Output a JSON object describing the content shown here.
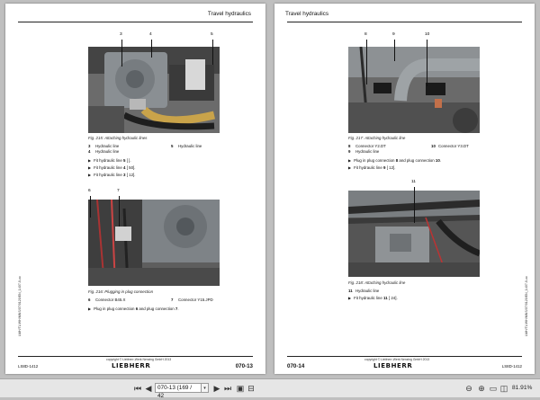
{
  "left_page": {
    "header": "Travel hydraulics",
    "fig1": {
      "callouts": [
        "3",
        "4",
        "5"
      ],
      "caption": "Fig. 215: Attaching hydraulic lines",
      "legend": [
        {
          "num": "3",
          "text": "Hydraulic line",
          "num2": "5",
          "text2": "Hydraulic line"
        },
        {
          "num": "4",
          "text": "Hydraulic line",
          "num2": "",
          "text2": ""
        }
      ],
      "steps": [
        {
          "pre": "Fit hydraulic line ",
          "num": "5",
          "post": " [ ]."
        },
        {
          "pre": "Fit hydraulic line ",
          "num": "4",
          "post": " [ 50]."
        },
        {
          "pre": "Fit hydraulic line ",
          "num": "3",
          "post": " [ 12]."
        }
      ]
    },
    "fig2": {
      "callouts": [
        "6",
        "7"
      ],
      "caption": "Fig. 216: Plugging in plug connection",
      "legend": [
        {
          "num": "6",
          "text": "Connector B45.X",
          "num2": "7",
          "text2": "Connector Y15.JPD"
        }
      ],
      "steps": [
        {
          "pre": "Plug in plug connection ",
          "num": "6",
          "post": " and plug connection ",
          "num_b": "7",
          "post_b": "."
        }
      ]
    },
    "side_code": "LMH/TL/WH/MNS/07/0120/EN_1407-0-xx",
    "copyright": "copyright © Liebherr-Werk Nenzing GmbH 2013",
    "logo": "LIEBHERR",
    "doc_id": "LS8D-1412",
    "page_number": "070-13"
  },
  "right_page": {
    "header": "Travel hydraulics",
    "fig1": {
      "callouts": [
        "8",
        "9",
        "10"
      ],
      "caption": "Fig. 217: Attaching hydraulic line",
      "legend": [
        {
          "num": "8",
          "text": "Connector Y2.DT",
          "num2": "10",
          "text2": "Connector Y3.DT"
        },
        {
          "num": "9",
          "text": "Hydraulic line",
          "num2": "",
          "text2": ""
        }
      ],
      "steps": [
        {
          "pre": "Plug in plug connection ",
          "num": "8",
          "post": " and plug connection ",
          "num_b": "10",
          "post_b": "."
        },
        {
          "pre": "Fit hydraulic line ",
          "num": "9",
          "post": " [ 12]."
        }
      ]
    },
    "fig2": {
      "callouts": [
        "11"
      ],
      "caption": "Fig. 218: Attaching hydraulic line",
      "legend": [
        {
          "num": "11",
          "text": "Hydraulic line",
          "num2": "",
          "text2": ""
        }
      ],
      "steps": [
        {
          "pre": "Fit hydraulic line ",
          "num": "11",
          "post": " [ 24]."
        }
      ]
    },
    "side_code": "LMH/TL/WH/MNS/07/0120/EN_1407-0-xx",
    "copyright": "copyright © Liebherr-Werk Nenzing GmbH 2013",
    "logo": "LIEBHERR",
    "doc_id": "LS8D-1412",
    "page_number": "070-14"
  },
  "toolbar": {
    "page_field": "070-13 (169 / 42",
    "zoom": "81.91%",
    "icons": [
      "first-page-icon",
      "prev-page-icon",
      "next-page-icon",
      "last-page-icon",
      "fit-page-icon",
      "fit-width-icon",
      "zoom-out-icon",
      "zoom-in-icon",
      "single-page-icon",
      "two-page-icon"
    ]
  }
}
